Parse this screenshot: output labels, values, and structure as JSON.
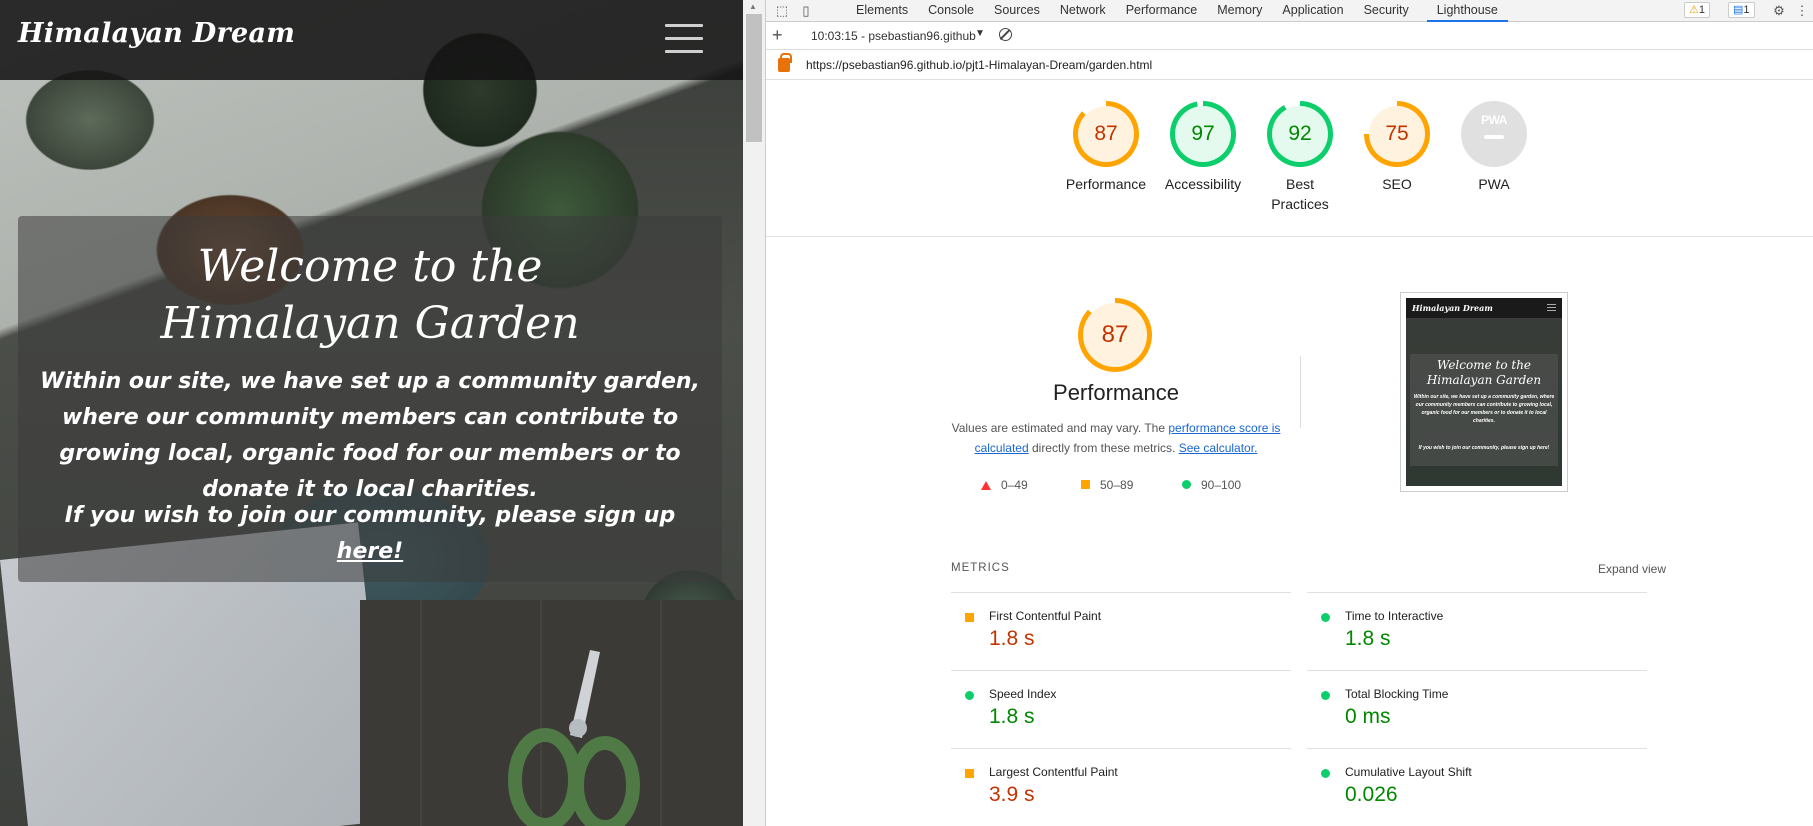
{
  "site": {
    "brand": "Himalayan Dream",
    "hero_title": "Welcome to the Himalayan Garden",
    "hero_text1": "Within our site, we have set up a community garden, where our community members can contribute to growing local, organic food for our members or to donate it to local charities.",
    "hero_text2_prefix": "If you wish to join our community, please sign up ",
    "hero_text2_link": "here!"
  },
  "devtools": {
    "tabs": [
      "Elements",
      "Console",
      "Sources",
      "Network",
      "Performance",
      "Memory",
      "Application",
      "Security",
      "Lighthouse"
    ],
    "active_tab": "Lighthouse",
    "warnings_count": "1",
    "messages_count": "1",
    "report_selector": "10:03:15 - psebastian96.github",
    "url": "https://psebastian96.github.io/pjt1-Himalayan-Dream/garden.html"
  },
  "scores": [
    {
      "label": "Performance",
      "value": 87,
      "rating": "orange"
    },
    {
      "label": "Accessibility",
      "value": 97,
      "rating": "green"
    },
    {
      "label": "Best Practices",
      "value": 92,
      "rating": "green"
    },
    {
      "label": "SEO",
      "value": 75,
      "rating": "orange"
    },
    {
      "label": "PWA",
      "value": null,
      "rating": "gray",
      "badge_text": "PWA"
    }
  ],
  "performance": {
    "score": 87,
    "title": "Performance",
    "desc_prefix": "Values are estimated and may vary. The ",
    "desc_link1": "performance score is calculated",
    "desc_mid": " directly from these metrics. ",
    "desc_link2": "See calculator.",
    "legend": [
      "0–49",
      "50–89",
      "90–100"
    ]
  },
  "screenshot": {
    "brand": "Himalayan Dream",
    "title": "Welcome to the Himalayan Garden",
    "text1": "Within our site, we have set up a community garden, where our community members can contribute to growing local, organic food for our members or to donate it to local charities.",
    "text2": "If you wish to join our community, please sign up here!"
  },
  "metrics": {
    "heading": "METRICS",
    "expand_label": "Expand view",
    "items": [
      {
        "name": "First Contentful Paint",
        "value": "1.8 s",
        "rating": "orange"
      },
      {
        "name": "Time to Interactive",
        "value": "1.8 s",
        "rating": "green"
      },
      {
        "name": "Speed Index",
        "value": "1.8 s",
        "rating": "green"
      },
      {
        "name": "Total Blocking Time",
        "value": "0 ms",
        "rating": "green"
      },
      {
        "name": "Largest Contentful Paint",
        "value": "3.9 s",
        "rating": "orange"
      },
      {
        "name": "Cumulative Layout Shift",
        "value": "0.026",
        "rating": "green"
      }
    ]
  },
  "colors": {
    "orange": "#ffa400",
    "green": "#0cce6b",
    "red": "#ff3333",
    "link": "#1967d2",
    "active_tab": "#1a73e8"
  }
}
